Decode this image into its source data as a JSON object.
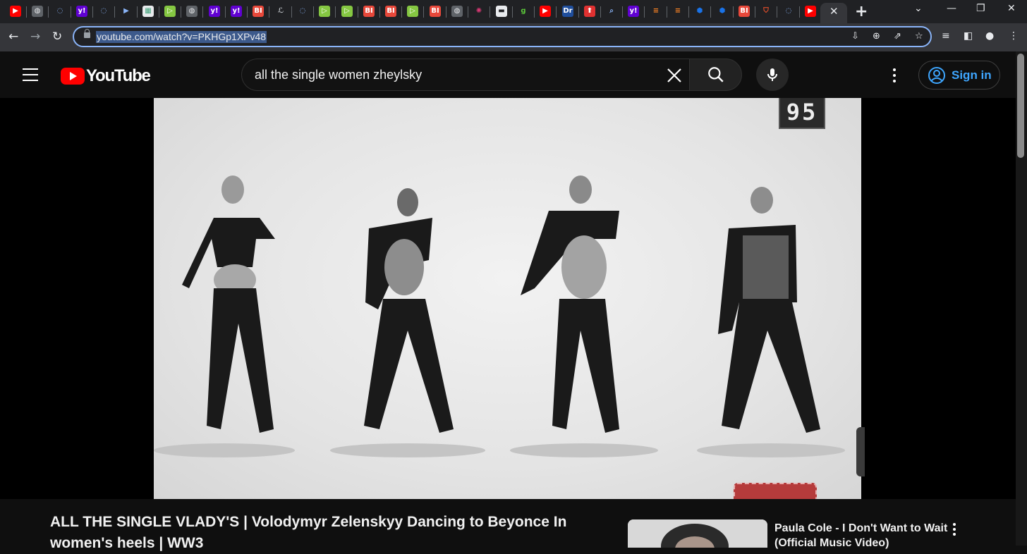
{
  "browser": {
    "url": "youtube.com/watch?v=PKHGp1XPv48",
    "tabs": [
      {
        "icon": "youtube-icon",
        "glyph": "▶",
        "bg": "#ff0000",
        "fg": "#ffffff"
      },
      {
        "icon": "globe-icon",
        "glyph": "◍",
        "bg": "#5f6368",
        "fg": "#e8eaed"
      },
      {
        "icon": "shield-icon",
        "glyph": "◌",
        "bg": "#202124",
        "fg": "#8ab4f8"
      },
      {
        "icon": "yahoo-icon",
        "glyph": "y!",
        "bg": "#6001d2",
        "fg": "#ffffff"
      },
      {
        "icon": "shield-icon",
        "glyph": "◌",
        "bg": "#202124",
        "fg": "#8ab4f8"
      },
      {
        "icon": "arrow-icon",
        "glyph": "▶",
        "bg": "#202124",
        "fg": "#8ab4f8"
      },
      {
        "icon": "grid-icon",
        "glyph": "▦",
        "bg": "#e8eaed",
        "fg": "#41a37b"
      },
      {
        "icon": "rumble-icon",
        "glyph": "▷",
        "bg": "#85c742",
        "fg": "#ffffff"
      },
      {
        "icon": "globe-icon",
        "glyph": "◍",
        "bg": "#5f6368",
        "fg": "#e8eaed"
      },
      {
        "icon": "yahoo-icon",
        "glyph": "y!",
        "bg": "#6001d2",
        "fg": "#ffffff"
      },
      {
        "icon": "yahoo-icon",
        "glyph": "y!",
        "bg": "#6001d2",
        "fg": "#ffffff"
      },
      {
        "icon": "bi-icon",
        "glyph": "BI",
        "bg": "#e8483a",
        "fg": "#ffffff"
      },
      {
        "icon": "italic-icon",
        "glyph": "ℒ",
        "bg": "#202124",
        "fg": "#bdc1c6"
      },
      {
        "icon": "shield-icon",
        "glyph": "◌",
        "bg": "#202124",
        "fg": "#8ab4f8"
      },
      {
        "icon": "rumble-icon",
        "glyph": "▷",
        "bg": "#85c742",
        "fg": "#ffffff"
      },
      {
        "icon": "rumble-icon",
        "glyph": "▷",
        "bg": "#85c742",
        "fg": "#ffffff"
      },
      {
        "icon": "bi-icon",
        "glyph": "BI",
        "bg": "#e8483a",
        "fg": "#ffffff"
      },
      {
        "icon": "bi-icon",
        "glyph": "BI",
        "bg": "#e8483a",
        "fg": "#ffffff"
      },
      {
        "icon": "rumble-icon",
        "glyph": "▷",
        "bg": "#85c742",
        "fg": "#ffffff"
      },
      {
        "icon": "bi-icon",
        "glyph": "BI",
        "bg": "#e8483a",
        "fg": "#ffffff"
      },
      {
        "icon": "globe-icon",
        "glyph": "◍",
        "bg": "#5f6368",
        "fg": "#e8eaed"
      },
      {
        "icon": "burst-icon",
        "glyph": "✺",
        "bg": "#202124",
        "fg": "#d93874"
      },
      {
        "icon": "news-icon",
        "glyph": "▬",
        "bg": "#e8eaed",
        "fg": "#202124"
      },
      {
        "icon": "g-icon",
        "glyph": "g",
        "bg": "#202124",
        "fg": "#5cc83b"
      },
      {
        "icon": "youtube-icon",
        "glyph": "▶",
        "bg": "#ff0000",
        "fg": "#ffffff"
      },
      {
        "icon": "dr-icon",
        "glyph": "Dr",
        "bg": "#1f4e9c",
        "fg": "#ffffff"
      },
      {
        "icon": "arrow-up-icon",
        "glyph": "⬆",
        "bg": "#e03131",
        "fg": "#ffffff"
      },
      {
        "icon": "search-icon",
        "glyph": "⌕",
        "bg": "#202124",
        "fg": "#8ab4f8"
      },
      {
        "icon": "yahoo-icon",
        "glyph": "y!",
        "bg": "#6001d2",
        "fg": "#ffffff"
      },
      {
        "icon": "bars-icon",
        "glyph": "≡",
        "bg": "#202124",
        "fg": "#f48024"
      },
      {
        "icon": "bars-icon",
        "glyph": "≡",
        "bg": "#202124",
        "fg": "#f48024"
      },
      {
        "icon": "hex-icon",
        "glyph": "⬢",
        "bg": "#202124",
        "fg": "#1a73e8"
      },
      {
        "icon": "hex-icon",
        "glyph": "⬢",
        "bg": "#202124",
        "fg": "#1a73e8"
      },
      {
        "icon": "bi-icon",
        "glyph": "BI",
        "bg": "#e8483a",
        "fg": "#ffffff"
      },
      {
        "icon": "brave-icon",
        "glyph": "⛉",
        "bg": "#202124",
        "fg": "#fb542b"
      },
      {
        "icon": "shield-icon",
        "glyph": "◌",
        "bg": "#202124",
        "fg": "#8ab4f8"
      },
      {
        "icon": "youtube-icon",
        "glyph": "▶",
        "bg": "#ff0000",
        "fg": "#ffffff"
      }
    ]
  },
  "youtube": {
    "logo_text": "YouTube",
    "search_query": "all the single women zheylsky",
    "signin_label": "Sign in",
    "video_badge": "95",
    "video_title": "ALL THE SINGLE VLADY'S | Volodymyr Zelenskyy Dancing to Beyonce In women's heels | WW3",
    "recommendation_title": "Paula Cole - I Don't Want to Wait (Official Music Video)"
  },
  "colors": {
    "youtube_red": "#ff0000",
    "link_blue": "#3ea6ff",
    "omnibox_focus": "#8ab4f8"
  }
}
